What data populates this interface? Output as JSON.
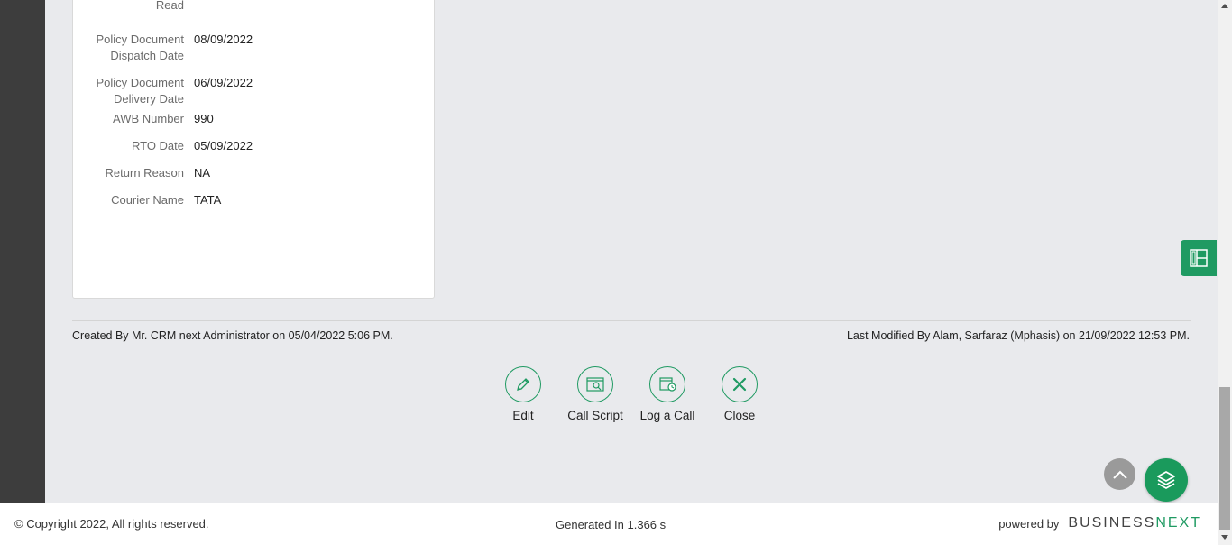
{
  "details": {
    "fields": [
      {
        "label": "Read",
        "value": ""
      },
      {
        "label": "Policy Document Dispatch Date",
        "value": "08/09/2022"
      },
      {
        "label": "Policy Document Delivery Date",
        "value": "06/09/2022"
      },
      {
        "label": "AWB Number",
        "value": "990"
      },
      {
        "label": "RTO Date",
        "value": "05/09/2022"
      },
      {
        "label": "Return Reason",
        "value": "NA"
      },
      {
        "label": "Courier Name",
        "value": "TATA"
      }
    ]
  },
  "audit": {
    "created": "Created By Mr. CRM next Administrator on 05/04/2022 5:06 PM.",
    "modified": "Last Modified By Alam, Sarfaraz (Mphasis) on 21/09/2022 12:53 PM."
  },
  "actions": {
    "edit": "Edit",
    "call_script": "Call Script",
    "log_call": "Log a Call",
    "close": "Close"
  },
  "footer": {
    "copyright": "© Copyright 2022, All rights reserved.",
    "generated": "Generated In 1.366 s",
    "powered_by": "powered by",
    "brand_part1": "BUSINESS",
    "brand_part2": "NEXT"
  },
  "icons": {
    "edit": "pencil-icon",
    "call_script": "script-icon",
    "log_call": "log-call-icon",
    "close": "close-icon",
    "side_tab": "layout-panel-icon",
    "to_top": "chevron-up-icon",
    "layers": "layers-icon"
  },
  "colors": {
    "accent": "#1f9a62",
    "rail": "#3d3d3d",
    "background": "#e9eaed"
  }
}
